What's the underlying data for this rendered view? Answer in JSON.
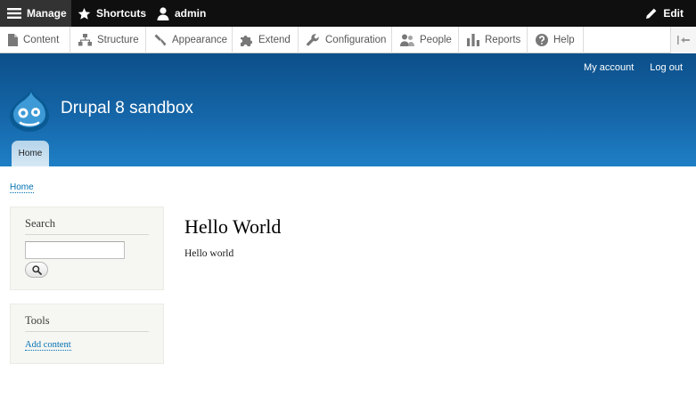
{
  "toolbar": {
    "manage": "Manage",
    "shortcuts": "Shortcuts",
    "user": "admin",
    "edit": "Edit"
  },
  "tray": {
    "items": [
      {
        "label": "Content",
        "icon": "file-icon"
      },
      {
        "label": "Structure",
        "icon": "structure-icon"
      },
      {
        "label": "Appearance",
        "icon": "paintbrush-icon"
      },
      {
        "label": "Extend",
        "icon": "puzzle-icon"
      },
      {
        "label": "Configuration",
        "icon": "wrench-icon"
      },
      {
        "label": "People",
        "icon": "people-icon"
      },
      {
        "label": "Reports",
        "icon": "bar-chart-icon"
      },
      {
        "label": "Help",
        "icon": "help-icon"
      }
    ]
  },
  "header": {
    "site_name": "Drupal 8 sandbox",
    "secondary_menu": [
      "My account",
      "Log out"
    ],
    "primary_tab": "Home"
  },
  "breadcrumb": "Home",
  "sidebar": {
    "search_title": "Search",
    "search_value": "",
    "tools_title": "Tools",
    "tools_link": "Add content"
  },
  "main": {
    "title": "Hello World",
    "body": "Hello world"
  },
  "colors": {
    "toolbar_bg": "#0f0f0f",
    "header_blue": "#1566a8",
    "link": "#0071b3",
    "block_bg": "#f6f6f2"
  }
}
